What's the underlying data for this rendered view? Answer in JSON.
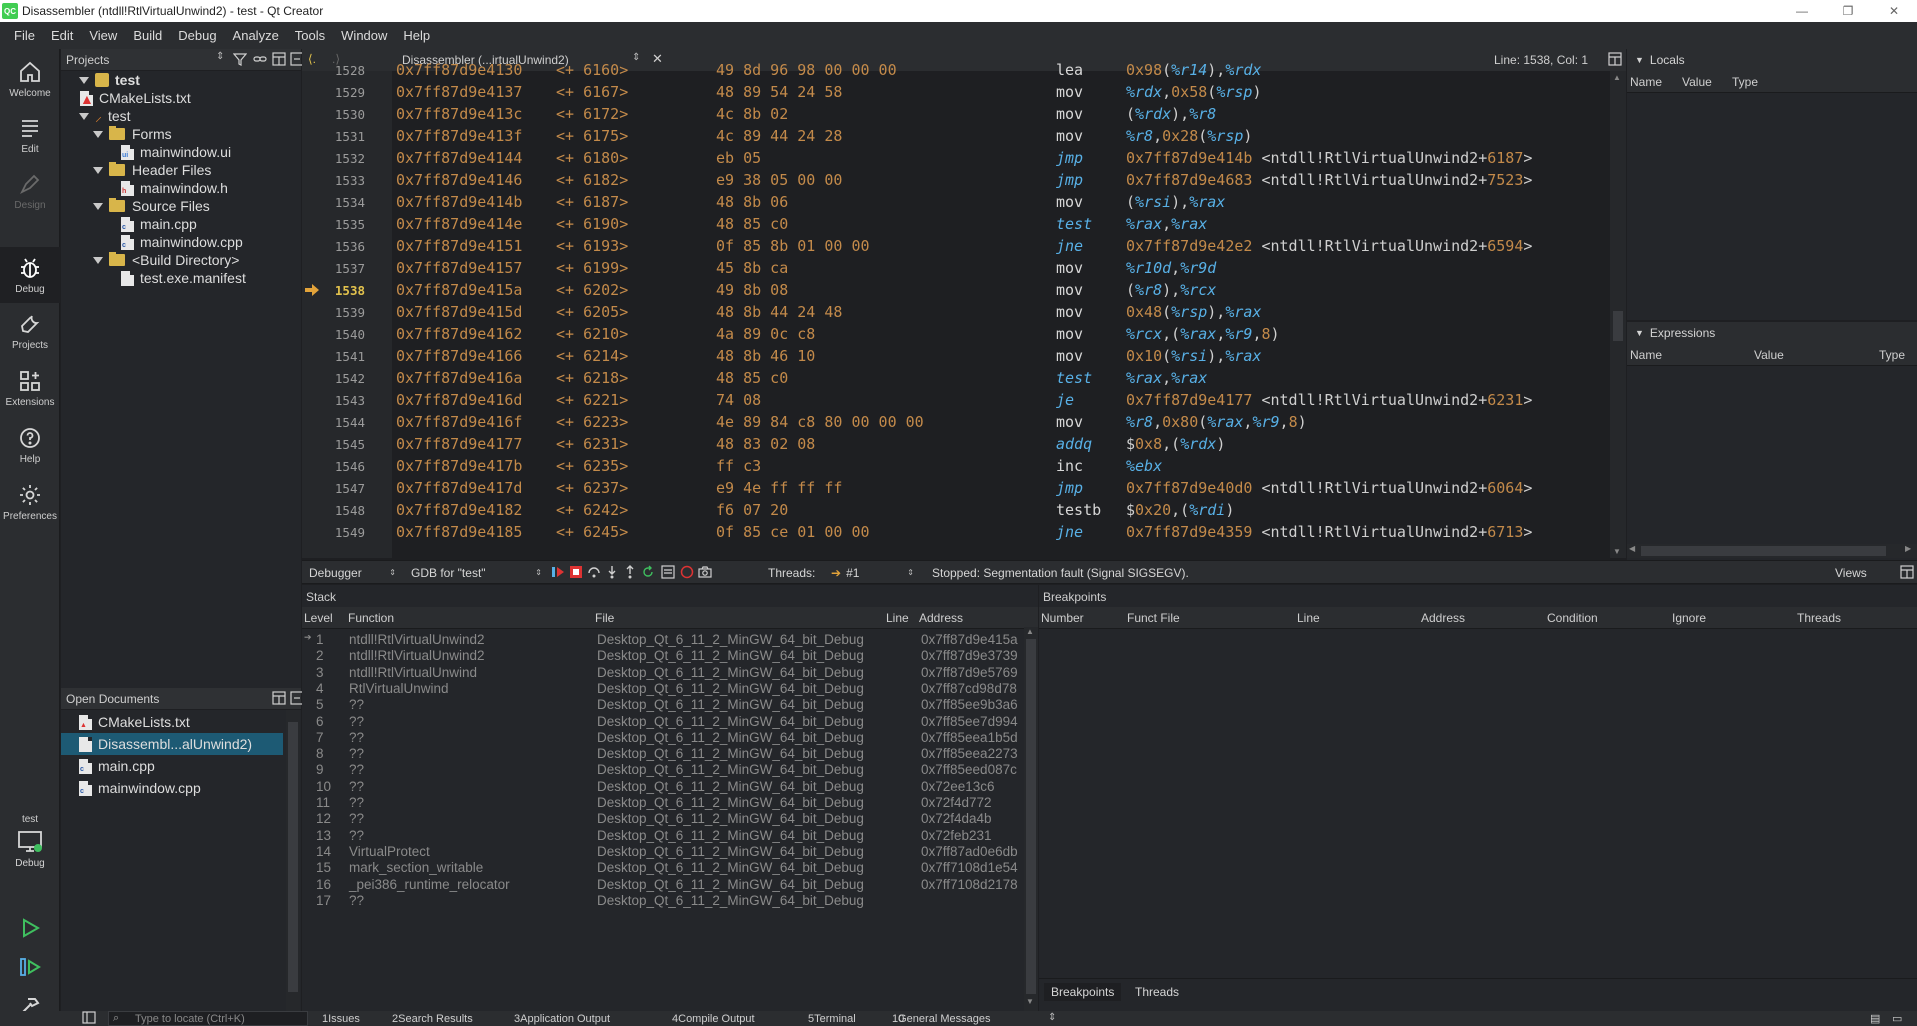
{
  "window": {
    "title": "Disassembler (ntdll!RtlVirtualUnwind2) - test - Qt Creator",
    "app_icon": "QC"
  },
  "menu": [
    "File",
    "Edit",
    "View",
    "Build",
    "Debug",
    "Analyze",
    "Tools",
    "Window",
    "Help"
  ],
  "modes": [
    {
      "label": "Welcome",
      "icon": "home-icon"
    },
    {
      "label": "Edit",
      "icon": "edit-icon"
    },
    {
      "label": "Design",
      "icon": "design-icon"
    },
    {
      "label": "Debug",
      "icon": "debug-icon"
    },
    {
      "label": "Projects",
      "icon": "wrench-icon"
    },
    {
      "label": "Extensions",
      "icon": "extensions-icon"
    },
    {
      "label": "Help",
      "icon": "help-icon"
    },
    {
      "label": "Preferences",
      "icon": "gear-icon"
    }
  ],
  "kit": {
    "project": "test",
    "mode": "Debug"
  },
  "projects": {
    "header": "Projects",
    "tree": [
      {
        "label": "test",
        "depth": 0,
        "kind": "project",
        "expanded": true
      },
      {
        "label": "CMakeLists.txt",
        "depth": 1,
        "kind": "cmake"
      },
      {
        "label": "test",
        "depth": 1,
        "kind": "target",
        "expanded": true
      },
      {
        "label": "Forms",
        "depth": 2,
        "kind": "folder",
        "expanded": true
      },
      {
        "label": "mainwindow.ui",
        "depth": 3,
        "kind": "ui"
      },
      {
        "label": "Header Files",
        "depth": 2,
        "kind": "folder",
        "expanded": true
      },
      {
        "label": "mainwindow.h",
        "depth": 3,
        "kind": "header"
      },
      {
        "label": "Source Files",
        "depth": 2,
        "kind": "folder",
        "expanded": true
      },
      {
        "label": "main.cpp",
        "depth": 3,
        "kind": "cpp"
      },
      {
        "label": "mainwindow.cpp",
        "depth": 3,
        "kind": "cpp"
      },
      {
        "label": "<Build Directory>",
        "depth": 2,
        "kind": "folder",
        "expanded": true
      },
      {
        "label": "test.exe.manifest",
        "depth": 3,
        "kind": "file"
      }
    ]
  },
  "open_documents": {
    "header": "Open Documents",
    "items": [
      {
        "label": "CMakeLists.txt",
        "kind": "cmake",
        "selected": false
      },
      {
        "label": "Disassembl...alUnwind2)",
        "kind": "file",
        "selected": true
      },
      {
        "label": "main.cpp",
        "kind": "cpp",
        "selected": false
      },
      {
        "label": "mainwindow.cpp",
        "kind": "cpp",
        "selected": false
      }
    ]
  },
  "editor": {
    "document": "Disassembler (...irtualUnwind2)",
    "position": "Line: 1538, Col: 1",
    "current_line": "1538",
    "lines": [
      {
        "n": "1528",
        "addr": "0x7ff87d9e4130",
        "off": "<+ 6160>",
        "hex": "49 8d 96 98 00 00 00",
        "mn": "lea",
        "jump": false,
        "ops": [
          [
            "num",
            "0x98"
          ],
          [
            "sym",
            "("
          ],
          [
            "reg",
            "%r14"
          ],
          [
            "sym",
            "),"
          ],
          [
            "reg",
            "%rdx"
          ]
        ]
      },
      {
        "n": "1529",
        "addr": "0x7ff87d9e4137",
        "off": "<+ 6167>",
        "hex": "48 89 54 24 58",
        "mn": "mov",
        "jump": false,
        "ops": [
          [
            "reg",
            "%rdx"
          ],
          [
            "sym",
            ","
          ],
          [
            "num",
            "0x58"
          ],
          [
            "sym",
            "("
          ],
          [
            "reg",
            "%rsp"
          ],
          [
            "sym",
            ")"
          ]
        ]
      },
      {
        "n": "1530",
        "addr": "0x7ff87d9e413c",
        "off": "<+ 6172>",
        "hex": "4c 8b 02",
        "mn": "mov",
        "jump": false,
        "ops": [
          [
            "sym",
            "("
          ],
          [
            "reg",
            "%rdx"
          ],
          [
            "sym",
            "),"
          ],
          [
            "reg",
            "%r8"
          ]
        ]
      },
      {
        "n": "1531",
        "addr": "0x7ff87d9e413f",
        "off": "<+ 6175>",
        "hex": "4c 89 44 24 28",
        "mn": "mov",
        "jump": false,
        "ops": [
          [
            "reg",
            "%r8"
          ],
          [
            "sym",
            ","
          ],
          [
            "num",
            "0x28"
          ],
          [
            "sym",
            "("
          ],
          [
            "reg",
            "%rsp"
          ],
          [
            "sym",
            ")"
          ]
        ]
      },
      {
        "n": "1532",
        "addr": "0x7ff87d9e4144",
        "off": "<+ 6180>",
        "hex": "eb 05",
        "mn": "jmp",
        "jump": true,
        "ops": [
          [
            "num",
            "0x7ff87d9e414b "
          ],
          [
            "sym",
            "<ntdll!RtlVirtualUnwind2+"
          ],
          [
            "num",
            "6187"
          ],
          [
            "sym",
            ">"
          ]
        ]
      },
      {
        "n": "1533",
        "addr": "0x7ff87d9e4146",
        "off": "<+ 6182>",
        "hex": "e9 38 05 00 00",
        "mn": "jmp",
        "jump": true,
        "ops": [
          [
            "num",
            "0x7ff87d9e4683 "
          ],
          [
            "sym",
            "<ntdll!RtlVirtualUnwind2+"
          ],
          [
            "num",
            "7523"
          ],
          [
            "sym",
            ">"
          ]
        ]
      },
      {
        "n": "1534",
        "addr": "0x7ff87d9e414b",
        "off": "<+ 6187>",
        "hex": "48 8b 06",
        "mn": "mov",
        "jump": false,
        "ops": [
          [
            "sym",
            "("
          ],
          [
            "reg",
            "%rsi"
          ],
          [
            "sym",
            "),"
          ],
          [
            "reg",
            "%rax"
          ]
        ]
      },
      {
        "n": "1535",
        "addr": "0x7ff87d9e414e",
        "off": "<+ 6190>",
        "hex": "48 85 c0",
        "mn": "test",
        "jump": true,
        "ops": [
          [
            "reg",
            "%rax"
          ],
          [
            "sym",
            ","
          ],
          [
            "reg",
            "%rax"
          ]
        ]
      },
      {
        "n": "1536",
        "addr": "0x7ff87d9e4151",
        "off": "<+ 6193>",
        "hex": "0f 85 8b 01 00 00",
        "mn": "jne",
        "jump": true,
        "ops": [
          [
            "num",
            "0x7ff87d9e42e2 "
          ],
          [
            "sym",
            "<ntdll!RtlVirtualUnwind2+"
          ],
          [
            "num",
            "6594"
          ],
          [
            "sym",
            ">"
          ]
        ]
      },
      {
        "n": "1537",
        "addr": "0x7ff87d9e4157",
        "off": "<+ 6199>",
        "hex": "45 8b ca",
        "mn": "mov",
        "jump": false,
        "ops": [
          [
            "reg",
            "%r10d"
          ],
          [
            "sym",
            ","
          ],
          [
            "reg",
            "%r9d"
          ]
        ]
      },
      {
        "n": "1538",
        "addr": "0x7ff87d9e415a",
        "off": "<+ 6202>",
        "hex": "49 8b 08",
        "mn": "mov",
        "jump": false,
        "ops": [
          [
            "sym",
            "("
          ],
          [
            "reg",
            "%r8"
          ],
          [
            "sym",
            "),"
          ],
          [
            "reg",
            "%rcx"
          ]
        ]
      },
      {
        "n": "1539",
        "addr": "0x7ff87d9e415d",
        "off": "<+ 6205>",
        "hex": "48 8b 44 24 48",
        "mn": "mov",
        "jump": false,
        "ops": [
          [
            "num",
            "0x48"
          ],
          [
            "sym",
            "("
          ],
          [
            "reg",
            "%rsp"
          ],
          [
            "sym",
            "),"
          ],
          [
            "reg",
            "%rax"
          ]
        ]
      },
      {
        "n": "1540",
        "addr": "0x7ff87d9e4162",
        "off": "<+ 6210>",
        "hex": "4a 89 0c c8",
        "mn": "mov",
        "jump": false,
        "ops": [
          [
            "reg",
            "%rcx"
          ],
          [
            "sym",
            ",("
          ],
          [
            "reg",
            "%rax"
          ],
          [
            "sym",
            ","
          ],
          [
            "reg",
            "%r9"
          ],
          [
            "sym",
            ","
          ],
          [
            "num",
            "8"
          ],
          [
            "sym",
            ")"
          ]
        ]
      },
      {
        "n": "1541",
        "addr": "0x7ff87d9e4166",
        "off": "<+ 6214>",
        "hex": "48 8b 46 10",
        "mn": "mov",
        "jump": false,
        "ops": [
          [
            "num",
            "0x10"
          ],
          [
            "sym",
            "("
          ],
          [
            "reg",
            "%rsi"
          ],
          [
            "sym",
            "),"
          ],
          [
            "reg",
            "%rax"
          ]
        ]
      },
      {
        "n": "1542",
        "addr": "0x7ff87d9e416a",
        "off": "<+ 6218>",
        "hex": "48 85 c0",
        "mn": "test",
        "jump": true,
        "ops": [
          [
            "reg",
            "%rax"
          ],
          [
            "sym",
            ","
          ],
          [
            "reg",
            "%rax"
          ]
        ]
      },
      {
        "n": "1543",
        "addr": "0x7ff87d9e416d",
        "off": "<+ 6221>",
        "hex": "74 08",
        "mn": "je",
        "jump": true,
        "ops": [
          [
            "num",
            "0x7ff87d9e4177 "
          ],
          [
            "sym",
            "<ntdll!RtlVirtualUnwind2+"
          ],
          [
            "num",
            "6231"
          ],
          [
            "sym",
            ">"
          ]
        ]
      },
      {
        "n": "1544",
        "addr": "0x7ff87d9e416f",
        "off": "<+ 6223>",
        "hex": "4e 89 84 c8 80 00 00 00",
        "mn": "mov",
        "jump": false,
        "ops": [
          [
            "reg",
            "%r8"
          ],
          [
            "sym",
            ","
          ],
          [
            "num",
            "0x80"
          ],
          [
            "sym",
            "("
          ],
          [
            "reg",
            "%rax"
          ],
          [
            "sym",
            ","
          ],
          [
            "reg",
            "%r9"
          ],
          [
            "sym",
            ","
          ],
          [
            "num",
            "8"
          ],
          [
            "sym",
            ")"
          ]
        ]
      },
      {
        "n": "1545",
        "addr": "0x7ff87d9e4177",
        "off": "<+ 6231>",
        "hex": "48 83 02 08",
        "mn": "addq",
        "jump": true,
        "ops": [
          [
            "sym",
            "$"
          ],
          [
            "num",
            "0x8"
          ],
          [
            "sym",
            ",("
          ],
          [
            "reg",
            "%rdx"
          ],
          [
            "sym",
            ")"
          ]
        ]
      },
      {
        "n": "1546",
        "addr": "0x7ff87d9e417b",
        "off": "<+ 6235>",
        "hex": "ff c3",
        "mn": "inc",
        "jump": false,
        "ops": [
          [
            "reg",
            "%ebx"
          ]
        ]
      },
      {
        "n": "1547",
        "addr": "0x7ff87d9e417d",
        "off": "<+ 6237>",
        "hex": "e9 4e ff ff ff",
        "mn": "jmp",
        "jump": true,
        "ops": [
          [
            "num",
            "0x7ff87d9e40d0 "
          ],
          [
            "sym",
            "<ntdll!RtlVirtualUnwind2+"
          ],
          [
            "num",
            "6064"
          ],
          [
            "sym",
            ">"
          ]
        ]
      },
      {
        "n": "1548",
        "addr": "0x7ff87d9e4182",
        "off": "<+ 6242>",
        "hex": "f6 07 20",
        "mn": "testb",
        "jump": false,
        "ops": [
          [
            "sym",
            "$"
          ],
          [
            "num",
            "0x20"
          ],
          [
            "sym",
            ",("
          ],
          [
            "reg",
            "%rdi"
          ],
          [
            "sym",
            ")"
          ]
        ]
      },
      {
        "n": "1549",
        "addr": "0x7ff87d9e4185",
        "off": "<+ 6245>",
        "hex": "0f 85 ce 01 00 00",
        "mn": "jne",
        "jump": true,
        "ops": [
          [
            "num",
            "0x7ff87d9e4359 "
          ],
          [
            "sym",
            "<ntdll!RtlVirtualUnwind2+"
          ],
          [
            "num",
            "6713"
          ],
          [
            "sym",
            ">"
          ]
        ]
      }
    ]
  },
  "locals": {
    "title": "Locals",
    "columns": [
      "Name",
      "Value",
      "Type"
    ]
  },
  "expressions": {
    "title": "Expressions",
    "columns": [
      "Name",
      "Value",
      "Type"
    ]
  },
  "debugger_bar": {
    "perspective": "Debugger",
    "engine": "GDB for \"test\"",
    "threads_label": "Threads:",
    "thread": "#1",
    "status": "Stopped: Segmentation fault (Signal SIGSEGV).",
    "views": "Views"
  },
  "stack": {
    "title": "Stack",
    "columns": [
      "Level",
      "Function",
      "File",
      "Line",
      "Address"
    ],
    "rows": [
      {
        "level": "1",
        "function": "ntdll!RtlVirtualUnwind2",
        "file": "Desktop_Qt_6_11_2_MinGW_64_bit_Debug",
        "line": "",
        "address": "0x7ff87d9e415a",
        "current": true
      },
      {
        "level": "2",
        "function": "ntdll!RtlVirtualUnwind2",
        "file": "Desktop_Qt_6_11_2_MinGW_64_bit_Debug",
        "line": "",
        "address": "0x7ff87d9e3739"
      },
      {
        "level": "3",
        "function": "ntdll!RtlVirtualUnwind",
        "file": "Desktop_Qt_6_11_2_MinGW_64_bit_Debug",
        "line": "",
        "address": "0x7ff87d9e5769"
      },
      {
        "level": "4",
        "function": "RtlVirtualUnwind",
        "file": "Desktop_Qt_6_11_2_MinGW_64_bit_Debug",
        "line": "",
        "address": "0x7ff87cd98d78"
      },
      {
        "level": "5",
        "function": "??",
        "file": "Desktop_Qt_6_11_2_MinGW_64_bit_Debug",
        "line": "",
        "address": "0x7ff85ee9b3a6"
      },
      {
        "level": "6",
        "function": "??",
        "file": "Desktop_Qt_6_11_2_MinGW_64_bit_Debug",
        "line": "",
        "address": "0x7ff85ee7d994"
      },
      {
        "level": "7",
        "function": "??",
        "file": "Desktop_Qt_6_11_2_MinGW_64_bit_Debug",
        "line": "",
        "address": "0x7ff85eea1b5d"
      },
      {
        "level": "8",
        "function": "??",
        "file": "Desktop_Qt_6_11_2_MinGW_64_bit_Debug",
        "line": "",
        "address": "0x7ff85eea2273"
      },
      {
        "level": "9",
        "function": "??",
        "file": "Desktop_Qt_6_11_2_MinGW_64_bit_Debug",
        "line": "",
        "address": "0x7ff85eed087c"
      },
      {
        "level": "10",
        "function": "??",
        "file": "Desktop_Qt_6_11_2_MinGW_64_bit_Debug",
        "line": "",
        "address": "0x72ee13c6"
      },
      {
        "level": "11",
        "function": "??",
        "file": "Desktop_Qt_6_11_2_MinGW_64_bit_Debug",
        "line": "",
        "address": "0x72f4d772"
      },
      {
        "level": "12",
        "function": "??",
        "file": "Desktop_Qt_6_11_2_MinGW_64_bit_Debug",
        "line": "",
        "address": "0x72f4da4b"
      },
      {
        "level": "13",
        "function": "??",
        "file": "Desktop_Qt_6_11_2_MinGW_64_bit_Debug",
        "line": "",
        "address": "0x72feb231"
      },
      {
        "level": "14",
        "function": "VirtualProtect",
        "file": "Desktop_Qt_6_11_2_MinGW_64_bit_Debug",
        "line": "",
        "address": "0x7ff87ad0e6db"
      },
      {
        "level": "15",
        "function": "mark_section_writable",
        "file": "Desktop_Qt_6_11_2_MinGW_64_bit_Debug",
        "line": "",
        "address": "0x7ff7108d1e54"
      },
      {
        "level": "16",
        "function": "_pei386_runtime_relocator",
        "file": "Desktop_Qt_6_11_2_MinGW_64_bit_Debug",
        "line": "",
        "address": "0x7ff7108d2178"
      },
      {
        "level": "17",
        "function": "??",
        "file": "Desktop_Qt_6_11_2_MinGW_64_bit_Debug",
        "line": "",
        "address": ""
      }
    ]
  },
  "breakpoints": {
    "title": "Breakpoints",
    "columns": [
      "Number",
      "Funct File",
      "Line",
      "Address",
      "Condition",
      "Ignore",
      "Threads"
    ],
    "tabs": [
      "Breakpoints",
      "Threads"
    ]
  },
  "statusbar": {
    "locator_placeholder": "Type to locate (Ctrl+K)",
    "panes": [
      {
        "num": "1",
        "label": "Issues"
      },
      {
        "num": "2",
        "label": "Search Results"
      },
      {
        "num": "3",
        "label": "Application Output"
      },
      {
        "num": "4",
        "label": "Compile Output"
      },
      {
        "num": "5",
        "label": "Terminal"
      },
      {
        "num": "10",
        "label": "General Messages"
      }
    ]
  },
  "colors": {
    "accent": "#1d5a74",
    "address": "#c38a4a",
    "register": "#58b0e6",
    "current_line": "#e2c24d",
    "run_green": "#3fbf5f"
  }
}
